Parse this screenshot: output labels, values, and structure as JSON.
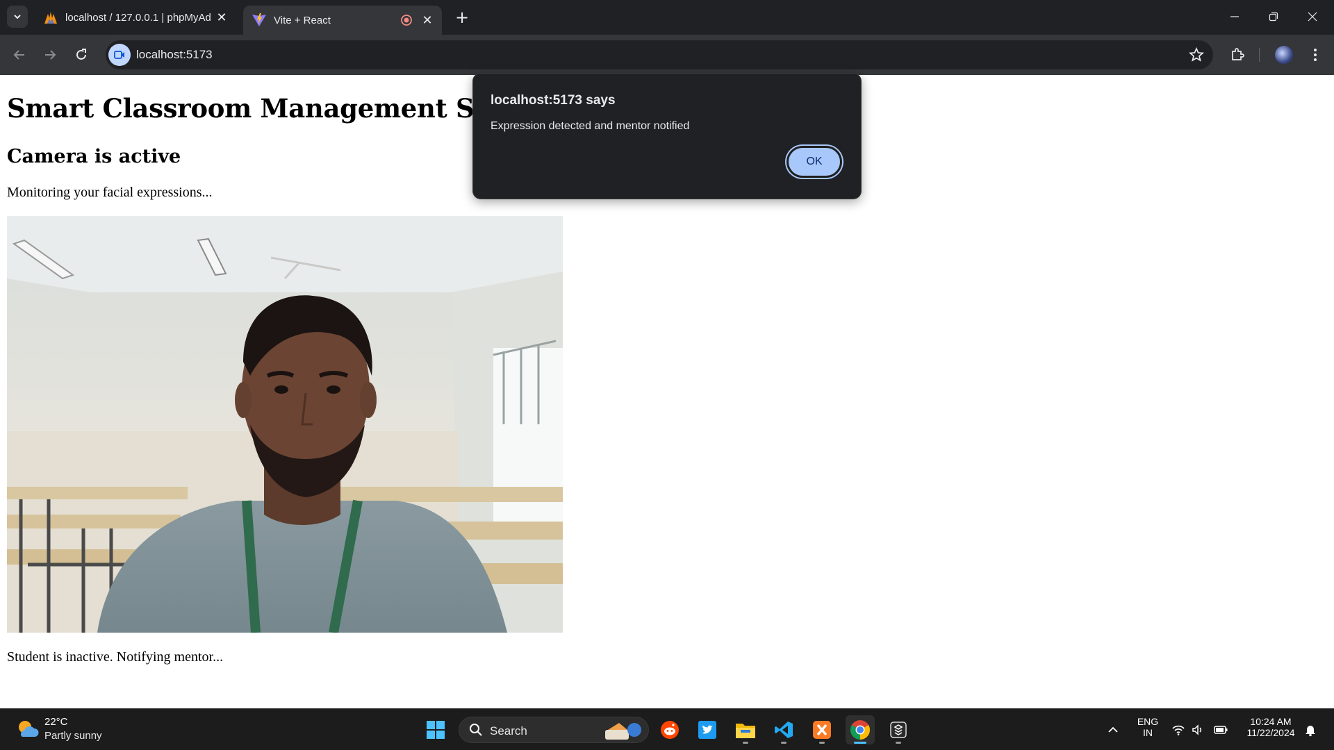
{
  "browser": {
    "tabs": [
      {
        "title": "localhost / 127.0.0.1 | phpMyAd",
        "active": false
      },
      {
        "title": "Vite + React",
        "active": true
      }
    ],
    "url": "localhost:5173"
  },
  "page": {
    "title": "Smart Classroom Management System",
    "camera_status": "Camera is active",
    "monitor_text": "Monitoring your facial expressions...",
    "student_status": "Student is inactive. Notifying mentor..."
  },
  "alert": {
    "title": "localhost:5173 says",
    "message": "Expression detected and mentor notified",
    "ok_label": "OK"
  },
  "taskbar": {
    "weather": {
      "temp": "22°C",
      "desc": "Partly sunny"
    },
    "search_label": "Search",
    "apps": [
      "start-icon",
      "reddit-icon",
      "twitter-icon",
      "file-explorer-icon",
      "vscode-icon",
      "xampp-icon",
      "chrome-icon",
      "app-icon"
    ],
    "language": {
      "line1": "ENG",
      "line2": "IN"
    },
    "time": "10:24 AM",
    "date": "11/22/2024"
  },
  "colors": {
    "accent": "#a8c7fa",
    "chrome_dark": "#202124",
    "taskbar": "#1c1c1c",
    "active_indicator": "#4cc2ff"
  }
}
